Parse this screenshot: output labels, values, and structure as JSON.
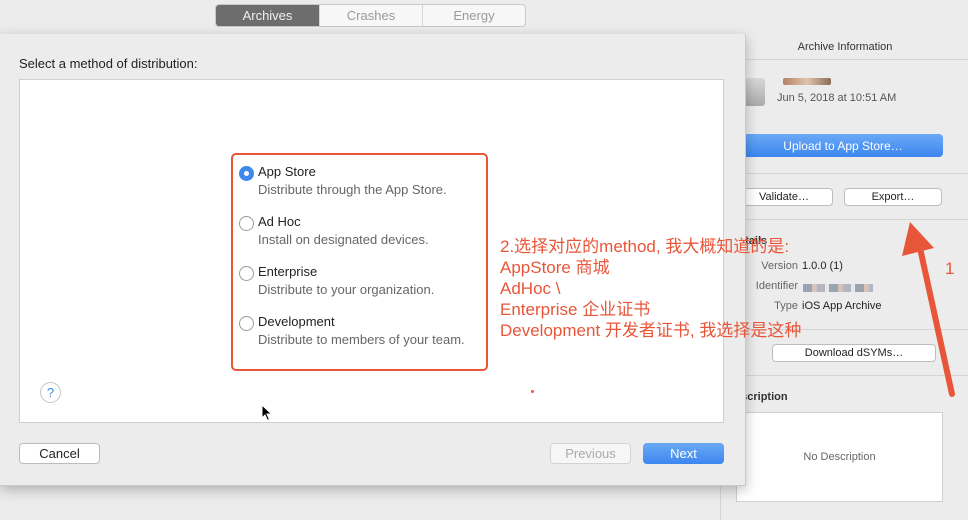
{
  "tabs": [
    {
      "label": "Archives",
      "active": true
    },
    {
      "label": "Crashes",
      "active": false
    },
    {
      "label": "Energy",
      "active": false
    }
  ],
  "dialog": {
    "title": "Select a method of distribution:",
    "options": [
      {
        "label": "App Store",
        "description": "Distribute through the App Store.",
        "selected": true
      },
      {
        "label": "Ad Hoc",
        "description": "Install on designated devices.",
        "selected": false
      },
      {
        "label": "Enterprise",
        "description": "Distribute to your organization.",
        "selected": false
      },
      {
        "label": "Development",
        "description": "Distribute to members of your team.",
        "selected": false
      }
    ],
    "help_label": "?",
    "cancel_label": "Cancel",
    "previous_label": "Previous",
    "next_label": "Next"
  },
  "annotation": {
    "lines": [
      "2.选择对应的method, 我大概知道的是:",
      " AppStore 商城",
      " AdHoc \\",
      " Enterprise 企业证书",
      " Development 开发者证书, 我选择是这种"
    ],
    "number_label": "1",
    "color": "#e8563a"
  },
  "inspector": {
    "header": "Archive Information",
    "archive_date": "Jun 5, 2018 at 10:51 AM",
    "upload_label": "Upload to App Store…",
    "validate_label": "Validate…",
    "export_label": "Export…",
    "details_title": "etails",
    "version_key": "Version",
    "version_value": "1.0.0 (1)",
    "identifier_key": "Identifier",
    "type_key": "Type",
    "type_value": "iOS App Archive",
    "download_dsyms_label": "Download dSYMs…",
    "description_title": "escription",
    "description_placeholder": "No Description"
  },
  "colors": {
    "accent": "#3d89ee",
    "annotation": "#e8563a"
  }
}
